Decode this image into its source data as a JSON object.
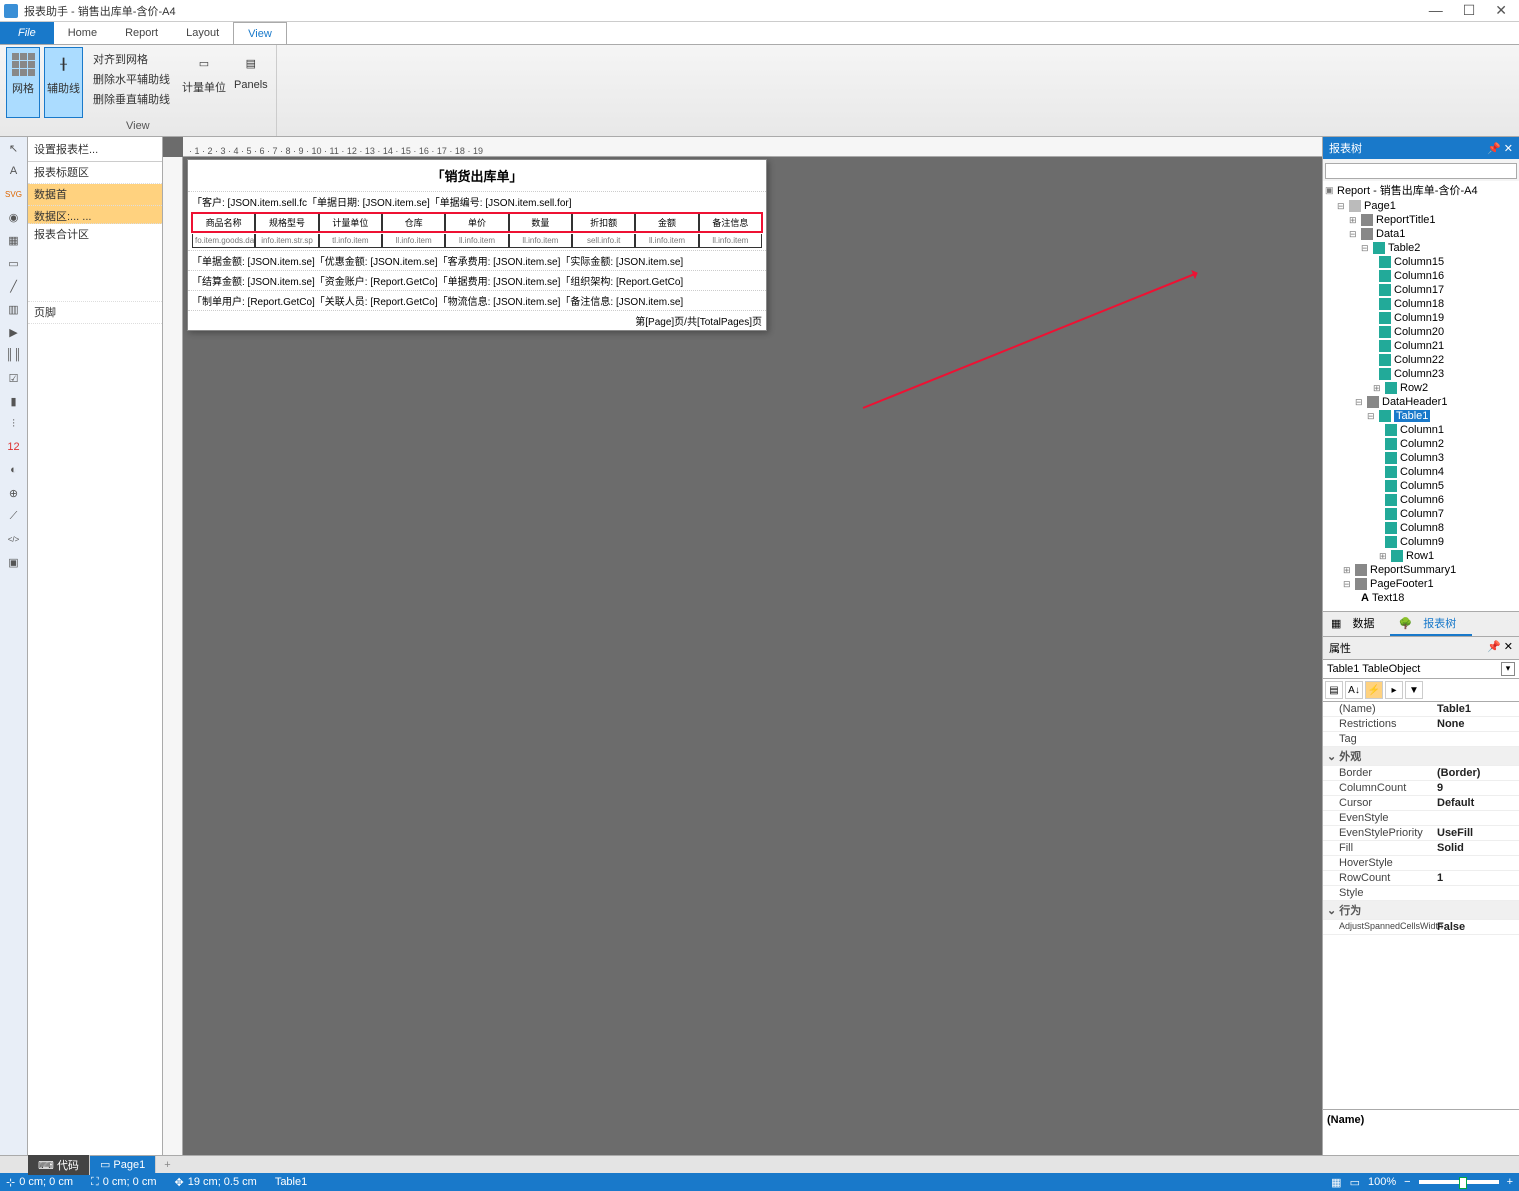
{
  "window": {
    "title": "报表助手 - 销售出库单-含价-A4"
  },
  "menu": {
    "file": "File",
    "home": "Home",
    "report": "Report",
    "layout": "Layout",
    "view": "View"
  },
  "ribbon": {
    "grid": "网格",
    "guides": "辅助线",
    "align_grid": "对齐到网格",
    "del_h_guide": "删除水平辅助线",
    "del_v_guide": "删除垂直辅助线",
    "units": "计量单位",
    "panels": "Panels",
    "group_label": "View"
  },
  "toolbar_hint": "设置报表栏...",
  "bands": {
    "title_band": "报表标题区",
    "data_header": "数据首",
    "data_band": "数据区:... ...",
    "summary_band": "报表合计区",
    "footer_band": "页脚"
  },
  "report": {
    "title": "「销货出库单」",
    "row1": "「客户: [JSON.item.sell.fc「单据日期: [JSON.item.se]「单据编号: [JSON.item.sell.for]",
    "tbl_headers": [
      "商品名称",
      "规格型号",
      "计量单位",
      "仓库",
      "单价",
      "数量",
      "折扣额",
      "金额",
      "备注信息"
    ],
    "tbl_data": [
      "fo.item.goods.data",
      "info.item.str.sp",
      "tl.info.item",
      "ll.info.item",
      "ll.info.item",
      "ll.info.item",
      "sell.info.it",
      "ll.info.item",
      "ll.info.item"
    ],
    "row3": "「单据金额: [JSON.item.se]「优惠金额: [JSON.item.se]「客承费用: [JSON.item.se]「实际金额: [JSON.item.se]",
    "row4": "「结算金额: [JSON.item.se]「资金账户: [Report.GetCo]「单据费用: [JSON.item.se]「组织架构: [Report.GetCo]",
    "row5": "「制单用户: [Report.GetCo]「关联人员: [Report.GetCo]「物流信息: [JSON.item.se]「备注信息: [JSON.item.se]",
    "footer": "第[Page]页/共[TotalPages]页"
  },
  "tree_panel": {
    "title": "报表树",
    "search_placeholder": "",
    "root": "Report - 销售出库单-含价-A4",
    "nodes": {
      "page1": "Page1",
      "data1": "Data1",
      "rtitle": "ReportTitle1",
      "table2": "Table2",
      "cols2": [
        "Column15",
        "Column16",
        "Column17",
        "Column18",
        "Column19",
        "Column20",
        "Column21",
        "Column22",
        "Column23"
      ],
      "row2": "Row2",
      "dheader": "DataHeader1",
      "table1": "Table1",
      "cols1": [
        "Column1",
        "Column2",
        "Column3",
        "Column4",
        "Column5",
        "Column6",
        "Column7",
        "Column8",
        "Column9"
      ],
      "row1": "Row1",
      "rsummary": "ReportSummary1",
      "pfooter": "PageFooter1",
      "text18": "Text18"
    }
  },
  "data_tabs": {
    "data": "数据",
    "tree": "报表树"
  },
  "props": {
    "title": "属性",
    "object": "Table1  TableObject",
    "rows": [
      {
        "k": "(Name)",
        "v": "Table1"
      },
      {
        "k": "Restrictions",
        "v": "None"
      },
      {
        "k": "Tag",
        "v": ""
      }
    ],
    "cat_appearance": "外观",
    "appearance": [
      {
        "k": "Border",
        "v": "(Border)"
      },
      {
        "k": "ColumnCount",
        "v": "9"
      },
      {
        "k": "Cursor",
        "v": "Default"
      },
      {
        "k": "EvenStyle",
        "v": ""
      },
      {
        "k": "EvenStylePriority",
        "v": "UseFill"
      },
      {
        "k": "Fill",
        "v": "Solid"
      },
      {
        "k": "HoverStyle",
        "v": ""
      },
      {
        "k": "RowCount",
        "v": "1"
      },
      {
        "k": "Style",
        "v": ""
      }
    ],
    "cat_behavior": "行为",
    "behavior": [
      {
        "k": "AdjustSpannedCellsWidth",
        "v": "False"
      }
    ],
    "desc": "(Name)"
  },
  "bottom": {
    "code": "代码",
    "page1": "Page1"
  },
  "status": {
    "pos": "0 cm; 0 cm",
    "size": "0 cm; 0 cm",
    "cursor": "19 cm; 0.5 cm",
    "sel": "Table1",
    "zoom": "100%"
  }
}
